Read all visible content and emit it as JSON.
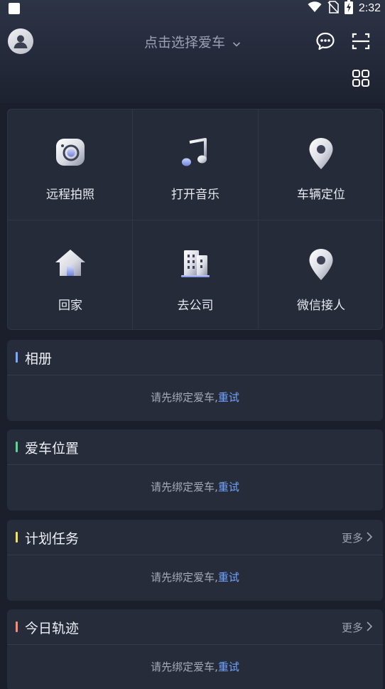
{
  "status_bar": {
    "time": "2:32"
  },
  "header": {
    "car_select_label": "点击选择爱车"
  },
  "functions": [
    {
      "label": "远程拍照",
      "icon": "camera-icon"
    },
    {
      "label": "打开音乐",
      "icon": "music-note-icon"
    },
    {
      "label": "车辆定位",
      "icon": "location-pin-icon"
    },
    {
      "label": "回家",
      "icon": "home-icon"
    },
    {
      "label": "去公司",
      "icon": "office-building-icon"
    },
    {
      "label": "微信接人",
      "icon": "location-pin-icon"
    }
  ],
  "cards": [
    {
      "title": "相册",
      "accent": "#7aa7ff",
      "message": "请先绑定爱车,",
      "retry": "重试"
    },
    {
      "title": "爱车位置",
      "accent": "#57d98f",
      "message": "请先绑定爱车,",
      "retry": "重试"
    },
    {
      "title": "计划任务",
      "accent": "#f5e25a",
      "more": "更多",
      "message": "请先绑定爱车,",
      "retry": "重试"
    },
    {
      "title": "今日轨迹",
      "accent": "#ff8a72",
      "more": "更多",
      "message": "请先绑定爱车,",
      "retry": "重试"
    }
  ],
  "colors": {
    "background": "#1b1f2b",
    "card": "#272c3a",
    "link": "#6fa3ff"
  }
}
